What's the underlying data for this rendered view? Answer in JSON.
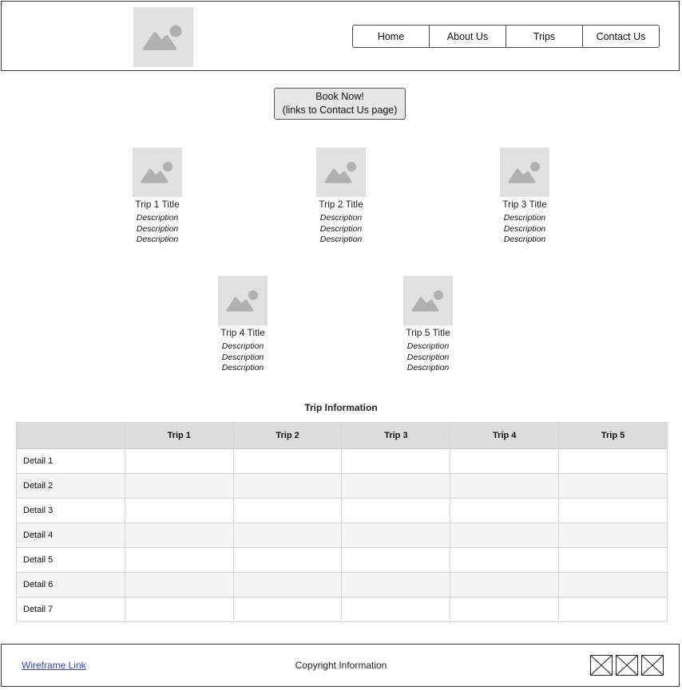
{
  "header": {
    "logo_icon": "image-placeholder-icon",
    "nav": [
      "Home",
      "About Us",
      "Trips",
      "Contact Us"
    ]
  },
  "book": {
    "line1": "Book Now!",
    "line2": "(links to Contact Us page)"
  },
  "trips": [
    {
      "title": "Trip 1 Title",
      "desc": [
        "Description",
        "Description",
        "Description"
      ]
    },
    {
      "title": "Trip 2 Title",
      "desc": [
        "Description",
        "Description",
        "Description"
      ]
    },
    {
      "title": "Trip 3 Title",
      "desc": [
        "Description",
        "Description",
        "Description"
      ]
    },
    {
      "title": "Trip 4 Title",
      "desc": [
        "Description",
        "Description",
        "Description"
      ]
    },
    {
      "title": "Trip 5 Title",
      "desc": [
        "Description",
        "Description",
        "Description"
      ]
    }
  ],
  "table": {
    "title": "Trip Information",
    "columns": [
      "",
      "Trip 1",
      "Trip 2",
      "Trip 3",
      "Trip 4",
      "Trip 5"
    ],
    "rows": [
      "Detail 1",
      "Detail 2",
      "Detail 3",
      "Detail 4",
      "Detail 5",
      "Detail 6",
      "Detail 7"
    ]
  },
  "footer": {
    "link": "Wireframe Link",
    "copyright": "Copyright Information",
    "icons": [
      "social-placeholder-icon",
      "social-placeholder-icon",
      "social-placeholder-icon"
    ]
  },
  "colors": {
    "placeholder_bg": "#e1e1e1",
    "placeholder_glyph": "#b0b0b0",
    "link": "#3344cc"
  }
}
